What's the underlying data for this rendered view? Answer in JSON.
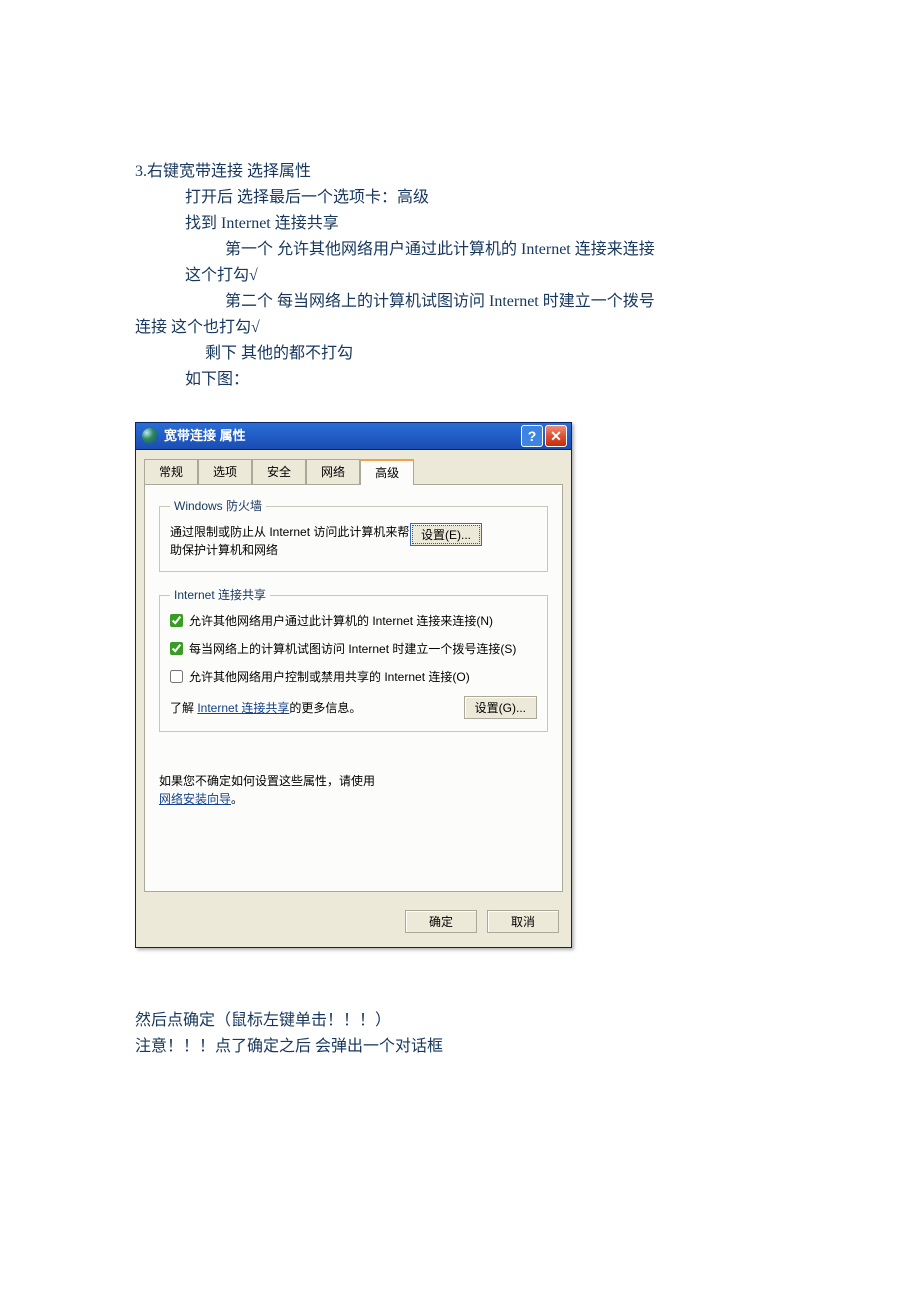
{
  "instructions": {
    "l1": "3.右键宽带连接 选择属性",
    "l2": "打开后 选择最后一个选项卡：高级",
    "l3": "找到 Internet 连接共享",
    "l4": "第一个    允许其他网络用户通过此计算机的 Internet 连接来连接",
    "l5": "这个打勾√",
    "l6": "第二个   每当网络上的计算机试图访问 Internet 时建立一个拨号",
    "l7": "连接   这个也打勾√",
    "l8": "剩下 其他的都不打勾",
    "l9": "如下图："
  },
  "dialog": {
    "title": "宽带连接 属性",
    "tabs": {
      "t1": "常规",
      "t2": "选项",
      "t3": "安全",
      "t4": "网络",
      "t5": "高级"
    },
    "firewall": {
      "legend": "Windows 防火墙",
      "text": "通过限制或防止从 Internet 访问此计算机来帮助保护计算机和网络",
      "btn": "设置(E)..."
    },
    "ics": {
      "legend": "Internet 连接共享",
      "c1": "允许其他网络用户通过此计算机的 Internet 连接来连接(N)",
      "c2": "每当网络上的计算机试图访问 Internet 时建立一个拨号连接(S)",
      "c3": "允许其他网络用户控制或禁用共享的 Internet 连接(O)",
      "more_pre": "了解 ",
      "more_link": "Internet 连接共享",
      "more_post": "的更多信息。",
      "btn": "设置(G)..."
    },
    "bottom": {
      "text": "如果您不确定如何设置这些属性，请使用",
      "link": "网络安装向导",
      "tail": "。"
    },
    "buttons": {
      "ok": "确定",
      "cancel": "取消"
    }
  },
  "notes": {
    "l1": "然后点确定（鼠标左键单击！！！）",
    "l2": "注意！！！点了确定之后   会弹出一个对话框"
  }
}
